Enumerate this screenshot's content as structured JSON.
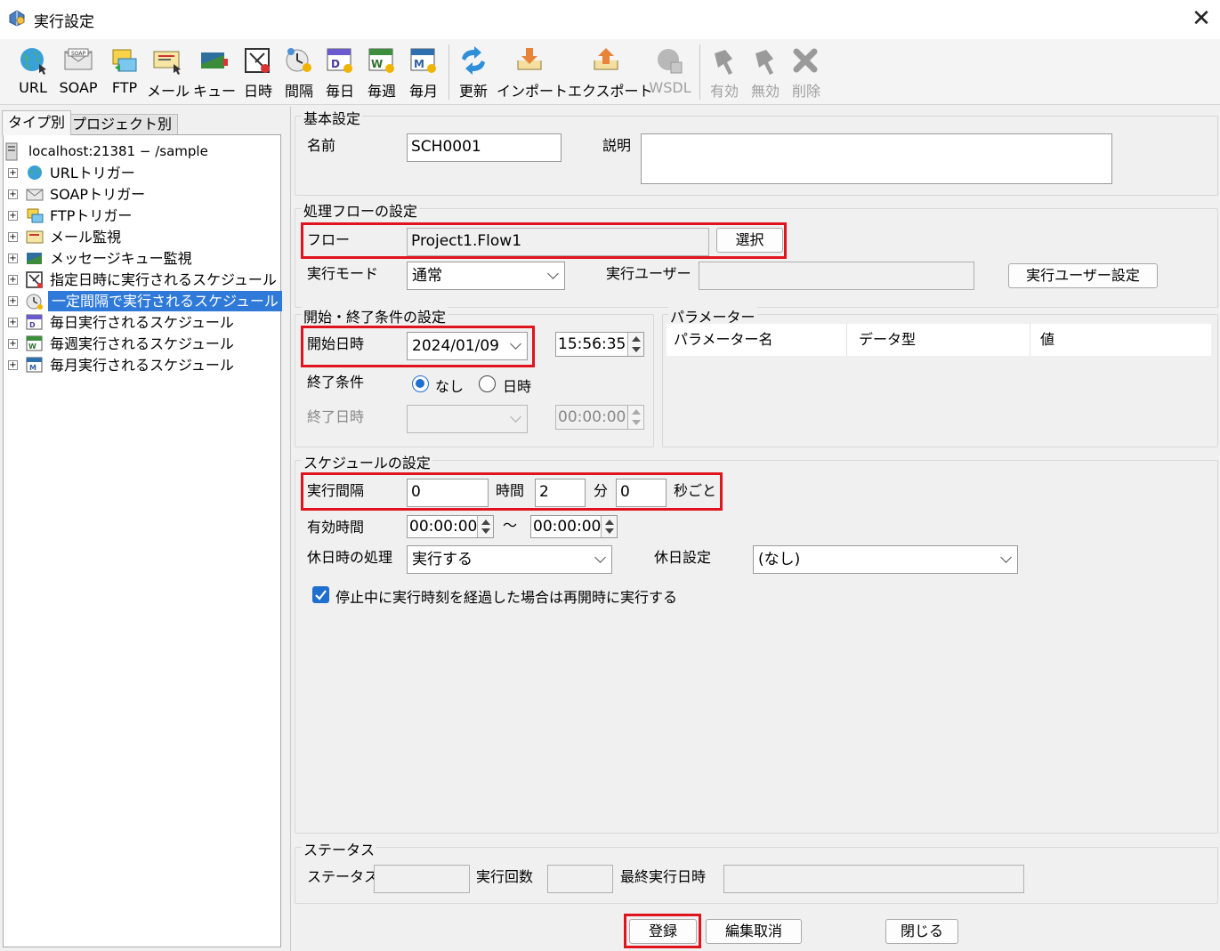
{
  "window": {
    "title": "実行設定"
  },
  "toolbar": {
    "items": [
      {
        "label": "URL",
        "icon": "globe-url-icon"
      },
      {
        "label": "SOAP",
        "icon": "soap-envelope-icon"
      },
      {
        "label": "FTP",
        "icon": "ftp-icon"
      },
      {
        "label": "メール",
        "icon": "mail-icon"
      },
      {
        "label": "キュー",
        "icon": "queue-icon"
      },
      {
        "label": "日時",
        "icon": "datetime-icon"
      },
      {
        "label": "間隔",
        "icon": "interval-icon"
      },
      {
        "label": "毎日",
        "icon": "daily-icon"
      },
      {
        "label": "毎週",
        "icon": "weekly-icon"
      },
      {
        "label": "毎月",
        "icon": "monthly-icon"
      },
      {
        "label": "更新",
        "icon": "refresh-icon"
      },
      {
        "label": "インポート",
        "icon": "import-icon"
      },
      {
        "label": "エクスポート",
        "icon": "export-icon"
      },
      {
        "label": "WSDL",
        "icon": "wsdl-icon",
        "disabled": true
      },
      {
        "label": "有効",
        "icon": "enable-icon",
        "disabled": true
      },
      {
        "label": "無効",
        "icon": "disable-icon",
        "disabled": true
      },
      {
        "label": "削除",
        "icon": "delete-icon",
        "disabled": true
      }
    ]
  },
  "left": {
    "tabs": [
      "タイプ別",
      "プロジェクト別"
    ],
    "tree": {
      "root": "localhost:21381 − /sample",
      "items": [
        "URLトリガー",
        "SOAPトリガー",
        "FTPトリガー",
        "メール監視",
        "メッセージキュー監視",
        "指定日時に実行されるスケジュール",
        "一定間隔で実行されるスケジュール",
        "毎日実行されるスケジュール",
        "毎週実行されるスケジュール",
        "毎月実行されるスケジュール"
      ],
      "selected_index": 6
    }
  },
  "basic": {
    "title": "基本設定",
    "name_label": "名前",
    "name_value": "SCH0001",
    "desc_label": "説明",
    "desc_value": ""
  },
  "flow": {
    "title": "処理フローの設定",
    "flow_label": "フロー",
    "flow_value": "Project1.Flow1",
    "select_button": "選択",
    "mode_label": "実行モード",
    "mode_value": "通常",
    "user_label": "実行ユーザー",
    "user_value": "",
    "user_button": "実行ユーザー設定"
  },
  "condition": {
    "title": "開始・終了条件の設定",
    "start_label": "開始日時",
    "start_date": "2024/01/09",
    "start_time": "15:56:35",
    "end_cond_label": "終了条件",
    "opt_none": "なし",
    "opt_datetime": "日時",
    "selected": "なし",
    "end_label": "終了日時",
    "end_date": "",
    "end_time": "00:00:00"
  },
  "params": {
    "title": "パラメーター",
    "columns": [
      "パラメーター名",
      "データ型",
      "値"
    ]
  },
  "schedule": {
    "title": "スケジュールの設定",
    "interval_label": "実行間隔",
    "hours": "0",
    "hours_unit": "時間",
    "minutes": "2",
    "minutes_unit": "分",
    "seconds": "0",
    "seconds_unit": "秒ごと",
    "valid_label": "有効時間",
    "valid_from": "00:00:00",
    "tilde": "〜",
    "valid_to": "00:00:00",
    "holiday_proc_label": "休日時の処理",
    "holiday_proc_value": "実行する",
    "holiday_setting_label": "休日設定",
    "holiday_setting_value": "(なし)",
    "resume_checkbox": "停止中に実行時刻を経過した場合は再開時に実行する",
    "resume_checked": true
  },
  "status": {
    "title": "ステータス",
    "status_label": "ステータス",
    "status_value": "",
    "count_label": "実行回数",
    "count_value": "",
    "last_label": "最終実行日時",
    "last_value": ""
  },
  "footer": {
    "register": "登録",
    "cancel": "編集取消",
    "close": "閉じる"
  }
}
